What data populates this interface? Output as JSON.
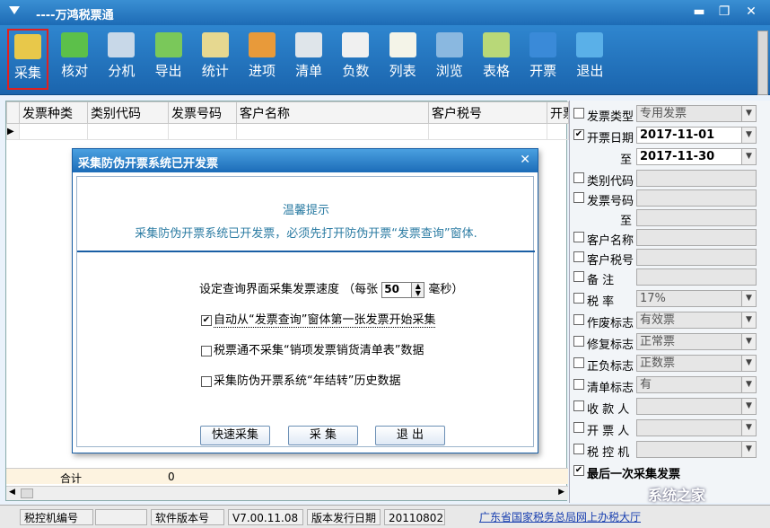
{
  "window": {
    "title": "----万鸿税票通",
    "controls": {
      "min": "▬",
      "restore": "❐",
      "close": "✕"
    }
  },
  "toolbar": {
    "buttons": [
      {
        "label": "采集",
        "icon": "collect-icon",
        "color": "#e8c84a"
      },
      {
        "label": "核对",
        "icon": "recycle-icon",
        "color": "#5cc04a"
      },
      {
        "label": "分机",
        "icon": "monitor-icon",
        "color": "#c8d8e8"
      },
      {
        "label": "导出",
        "icon": "export-icon",
        "color": "#7ac85a"
      },
      {
        "label": "统计",
        "icon": "statistics-icon",
        "color": "#e6d890"
      },
      {
        "label": "进项",
        "icon": "input-invoice-icon",
        "color": "#e89a3a"
      },
      {
        "label": "清单",
        "icon": "printer-icon",
        "color": "#dfe5ea"
      },
      {
        "label": "负数",
        "icon": "negative-icon",
        "color": "#f0f0f0"
      },
      {
        "label": "列表",
        "icon": "list-icon",
        "color": "#f4f4e8"
      },
      {
        "label": "浏览",
        "icon": "browse-icon",
        "color": "#8ab8e0"
      },
      {
        "label": "表格",
        "icon": "table-icon",
        "color": "#b8d878"
      },
      {
        "label": "开票",
        "icon": "issue-invoice-icon",
        "color": "#3a8ad8"
      },
      {
        "label": "退出",
        "icon": "exit-icon",
        "color": "#5ab0e8"
      }
    ]
  },
  "grid": {
    "columns": [
      "发票种类",
      "类别代码",
      "发票号码",
      "客户名称",
      "客户税号",
      "开票"
    ],
    "sum_label": "合计",
    "sum_value": "0",
    "row_marker": "▶"
  },
  "filters": [
    {
      "label": "发票类型",
      "value": "专用发票",
      "checked": false,
      "type": "select"
    },
    {
      "label": "开票日期",
      "value": "2017-11-01",
      "checked": true,
      "type": "date"
    },
    {
      "label": "至",
      "value": "2017-11-30",
      "checked": null,
      "type": "date"
    },
    {
      "label": "类别代码",
      "value": "",
      "checked": false,
      "type": "text"
    },
    {
      "label": "发票号码",
      "value": "",
      "checked": false,
      "type": "text"
    },
    {
      "label": "至",
      "value": "",
      "checked": null,
      "type": "text"
    },
    {
      "label": "客户名称",
      "value": "",
      "checked": false,
      "type": "text"
    },
    {
      "label": "客户税号",
      "value": "",
      "checked": false,
      "type": "text"
    },
    {
      "label": "备  注",
      "value": "",
      "checked": false,
      "type": "text"
    },
    {
      "label": "税  率",
      "value": "17%",
      "checked": false,
      "type": "select"
    },
    {
      "label": "作废标志",
      "value": "有效票",
      "checked": false,
      "type": "select"
    },
    {
      "label": "修复标志",
      "value": "正常票",
      "checked": false,
      "type": "select"
    },
    {
      "label": "正负标志",
      "value": "正数票",
      "checked": false,
      "type": "select"
    },
    {
      "label": "清单标志",
      "value": "有",
      "checked": false,
      "type": "select"
    },
    {
      "label": "收 款 人",
      "value": "",
      "checked": false,
      "type": "select"
    },
    {
      "label": "开 票 人",
      "value": "",
      "checked": false,
      "type": "select"
    },
    {
      "label": "税 控 机",
      "value": "",
      "checked": false,
      "type": "select"
    },
    {
      "label": "最后一次采集发票",
      "value": "",
      "checked": true,
      "type": "check"
    }
  ],
  "dialog": {
    "title": "采集防伪开票系统已开发票",
    "close": "✕",
    "tip_title": "温馨提示",
    "tip_text": "采集防伪开票系统已开发票，必须先打开防伪开票“发票查询”窗体.",
    "speed_prefix": "设定查询界面采集发票速度  （每张",
    "speed_value": "50",
    "speed_suffix": "毫秒）",
    "options": [
      {
        "label": "自动从“发票查询”窗体第一张发票开始采集",
        "checked": true
      },
      {
        "label": "税票通不采集“销项发票销货清单表”数据",
        "checked": false
      },
      {
        "label": "采集防伪开票系统“年结转”历史数据",
        "checked": false
      }
    ],
    "buttons": {
      "quick": "快速采集",
      "collect": "采    集",
      "exit": "退    出"
    }
  },
  "status": {
    "machine_label": "税控机编号",
    "machine_value": "",
    "version_label": "软件版本号",
    "version_value": "V7.00.11.08",
    "release_label": "版本发行日期",
    "release_value": "20110802",
    "link": "广东省国家税务总局网上办税大厅"
  },
  "watermark": "系统之家"
}
